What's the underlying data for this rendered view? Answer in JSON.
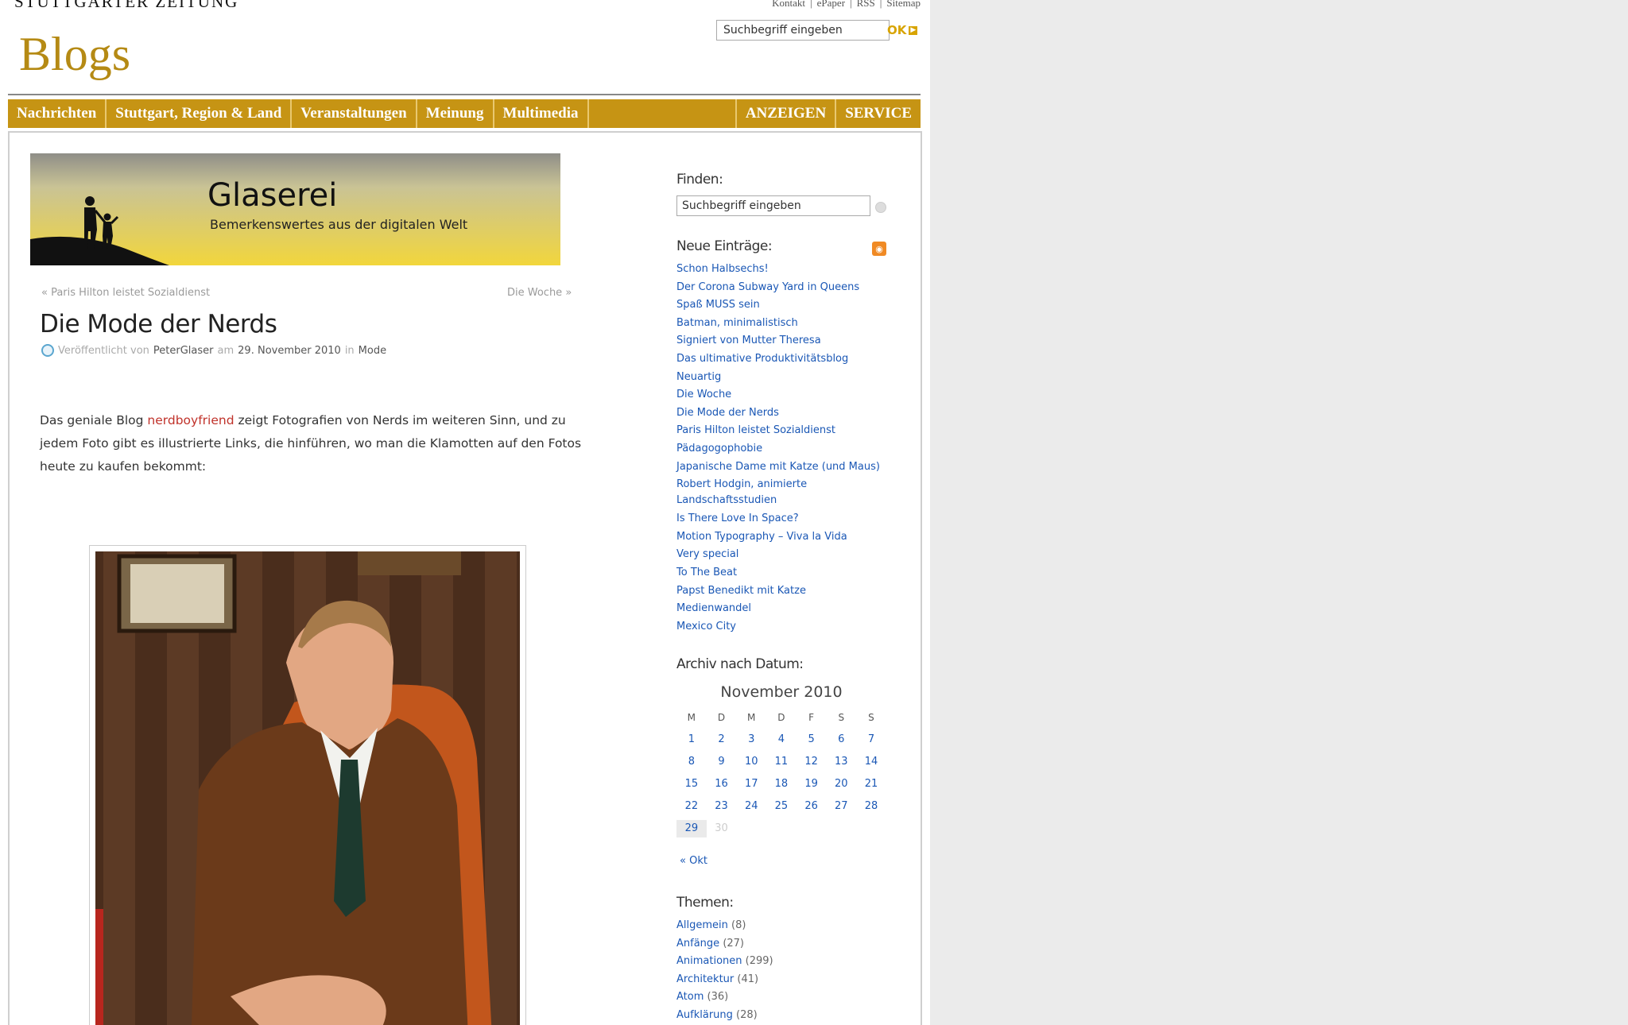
{
  "header": {
    "masthead": "STUTTGARTER ZEITUNG",
    "toplinks": [
      "Kontakt",
      "ePaper",
      "RSS",
      "Sitemap"
    ],
    "blogs_title": "Blogs",
    "search_placeholder": "Suchbegriff eingeben",
    "ok_label": "OK"
  },
  "nav": {
    "items": [
      "Nachrichten",
      "Stuttgart, Region & Land",
      "Veranstaltungen",
      "Meinung",
      "Multimedia"
    ],
    "right": [
      "ANZEIGEN",
      "SERVICE"
    ]
  },
  "banner": {
    "title": "Glaserei",
    "subtitle": "Bemerkenswertes aus der digitalen Welt"
  },
  "post": {
    "prev": "« Paris Hilton leistet Sozialdienst",
    "next": "Die Woche »",
    "title": "Die Mode der Nerds",
    "meta": {
      "published": "Veröffentlicht von",
      "author": "PeterGlaser",
      "am": "am",
      "date": "29. November 2010",
      "in": "in",
      "category": "Mode"
    },
    "body_before": "Das geniale Blog ",
    "body_link": "nerdboyfriend",
    "body_after": " zeigt Fotografien von Nerds im weiteren Sinn, und zu jedem Foto gibt es illustrierte Links, die hinführen, wo man die Klamotten auf den Fotos heute zu kaufen bekommt:"
  },
  "sidebar": {
    "finden": "Finden:",
    "search_placeholder": "Suchbegriff eingeben",
    "neue_heading": "Neue Einträge:",
    "entries": [
      "Schon Halbsechs!",
      "Der Corona Subway Yard in Queens",
      "Spaß MUSS sein",
      "Batman, minimalistisch",
      "Signiert von Mutter Theresa",
      "Das ultimative Produktivitätsblog",
      "Neuartig",
      "Die Woche",
      "Die Mode der Nerds",
      "Paris Hilton leistet Sozialdienst",
      "Pädagogophobie",
      "Japanische Dame mit Katze (und Maus)",
      "Robert Hodgin, animierte Landschaftsstudien",
      "Is There Love In Space?",
      "Motion Typography – Viva la Vida",
      "Very special",
      "To The Beat",
      "Papst Benedikt mit Katze",
      "Medienwandel",
      "Mexico City"
    ],
    "archiv_heading": "Archiv nach Datum:",
    "calendar": {
      "caption": "November 2010",
      "weekdays": [
        "M",
        "D",
        "M",
        "D",
        "F",
        "S",
        "S"
      ],
      "days": [
        "1",
        "2",
        "3",
        "4",
        "5",
        "6",
        "7",
        "8",
        "9",
        "10",
        "11",
        "12",
        "13",
        "14",
        "15",
        "16",
        "17",
        "18",
        "19",
        "20",
        "21",
        "22",
        "23",
        "24",
        "25",
        "26",
        "27",
        "28",
        "29",
        "30"
      ],
      "prev": "« Okt"
    },
    "themen_heading": "Themen:",
    "themes": [
      {
        "name": "Allgemein",
        "count": "(8)"
      },
      {
        "name": "Anfänge",
        "count": "(27)"
      },
      {
        "name": "Animationen",
        "count": "(299)"
      },
      {
        "name": "Architektur",
        "count": "(41)"
      },
      {
        "name": "Atom",
        "count": "(36)"
      },
      {
        "name": "Aufklärung",
        "count": "(28)"
      }
    ]
  },
  "colors": {
    "nav_gold": "#c69414",
    "brand_gold": "#b58a14",
    "link_blue": "#1a57b5",
    "link_red": "#c0322a"
  }
}
